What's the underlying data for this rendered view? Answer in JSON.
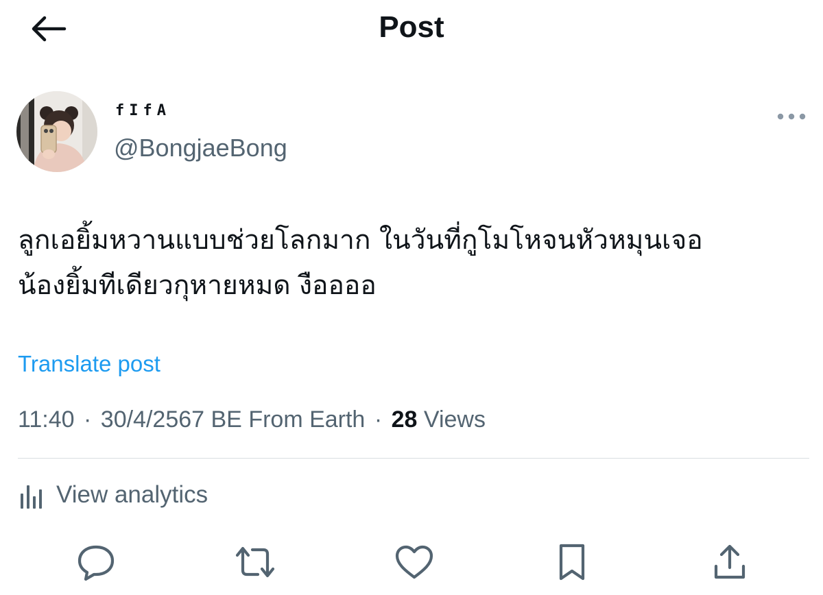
{
  "header": {
    "title": "Post",
    "back_icon": "arrow-left-icon"
  },
  "author": {
    "display_name": "fIfA",
    "handle": "@BongjaeBong",
    "avatar": "profile-photo"
  },
  "post": {
    "text": "ลูกเอยิ้มหวานแบบช่วยโลกมาก ในวันที่กูโมโหจนหัวหมุนเจอ\nน้องยิ้มทีเดียวกุหายหมด งืออออ",
    "translate_label": "Translate post",
    "time": "11:40",
    "date": "30/4/2567 BE",
    "source": "From Earth",
    "separator": "·",
    "views_count": "28",
    "views_label": "Views"
  },
  "analytics": {
    "label": "View analytics",
    "icon": "analytics-icon"
  },
  "actions": [
    {
      "name": "reply",
      "icon": "reply-icon"
    },
    {
      "name": "repost",
      "icon": "repost-icon"
    },
    {
      "name": "like",
      "icon": "heart-icon"
    },
    {
      "name": "bookmark",
      "icon": "bookmark-icon"
    },
    {
      "name": "share",
      "icon": "share-icon"
    }
  ],
  "colors": {
    "text": "#0f1419",
    "secondary": "#536471",
    "link": "#1d9bf0",
    "divider": "#d9dde1"
  }
}
